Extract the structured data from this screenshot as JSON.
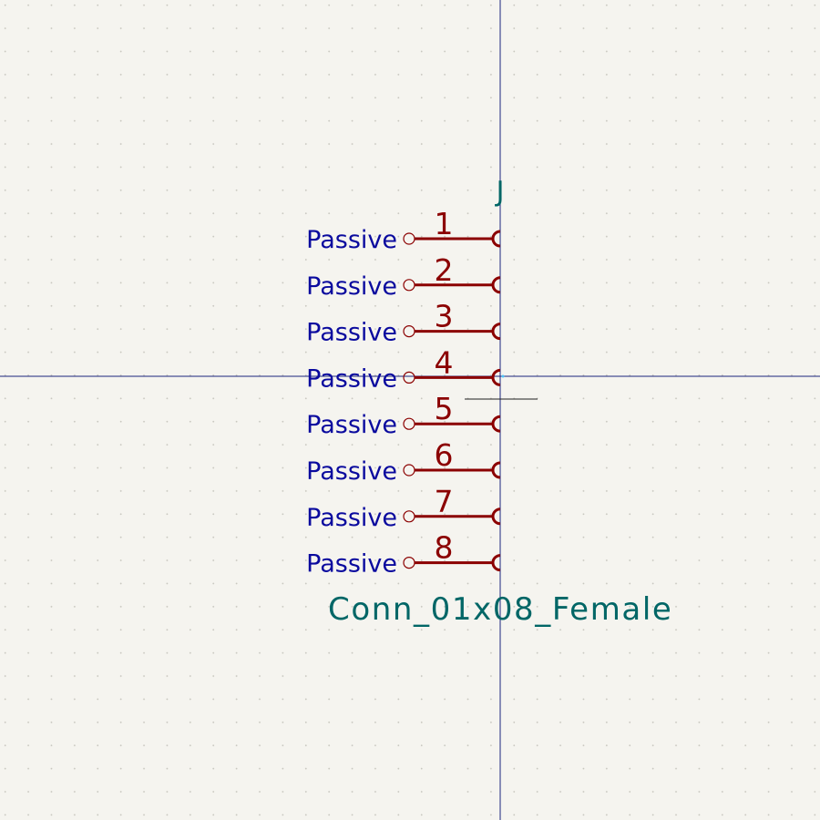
{
  "symbol": {
    "reference": "J",
    "value": "Conn_01x08_Female",
    "pins": [
      {
        "number": "1",
        "type": "Passive"
      },
      {
        "number": "2",
        "type": "Passive"
      },
      {
        "number": "3",
        "type": "Passive"
      },
      {
        "number": "4",
        "type": "Passive"
      },
      {
        "number": "5",
        "type": "Passive"
      },
      {
        "number": "6",
        "type": "Passive"
      },
      {
        "number": "7",
        "type": "Passive"
      },
      {
        "number": "8",
        "type": "Passive"
      }
    ]
  },
  "colors": {
    "background": "#f5f4ef",
    "pin": "#8b0000",
    "pin_type_text": "#0a0a9e",
    "field_text": "#006666",
    "axis": "#1a237e",
    "cursor": "#202020"
  }
}
